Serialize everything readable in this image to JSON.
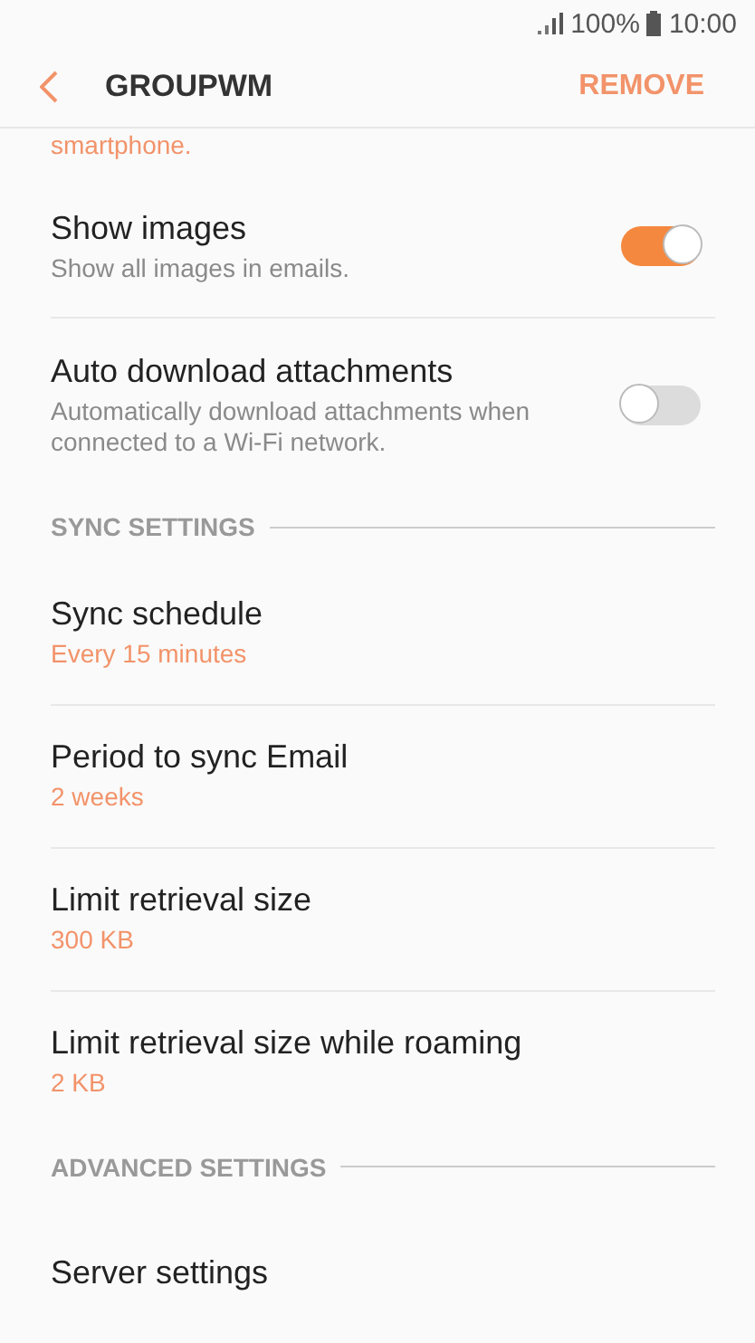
{
  "status_bar": {
    "battery": "100%",
    "time": "10:00"
  },
  "header": {
    "title": "GROUPWM",
    "action": "REMOVE"
  },
  "cut_text": "smartphone.",
  "sections": [
    {
      "items": [
        {
          "kind": "toggle",
          "title": "Show images",
          "subtitle": "Show all images in emails.",
          "on": true
        },
        {
          "kind": "toggle",
          "title": "Auto download attachments",
          "subtitle": "Automatically download attachments when connected to a Wi-Fi network.",
          "on": false
        }
      ]
    },
    {
      "header": "SYNC SETTINGS",
      "items": [
        {
          "kind": "value",
          "title": "Sync schedule",
          "value": "Every 15 minutes"
        },
        {
          "kind": "value",
          "title": "Period to sync Email",
          "value": "2 weeks"
        },
        {
          "kind": "value",
          "title": "Limit retrieval size",
          "value": "300 KB"
        },
        {
          "kind": "value",
          "title": "Limit retrieval size while roaming",
          "value": "2 KB"
        }
      ]
    },
    {
      "header": "ADVANCED SETTINGS",
      "items": [
        {
          "kind": "plain",
          "title": "Server settings"
        }
      ]
    }
  ]
}
